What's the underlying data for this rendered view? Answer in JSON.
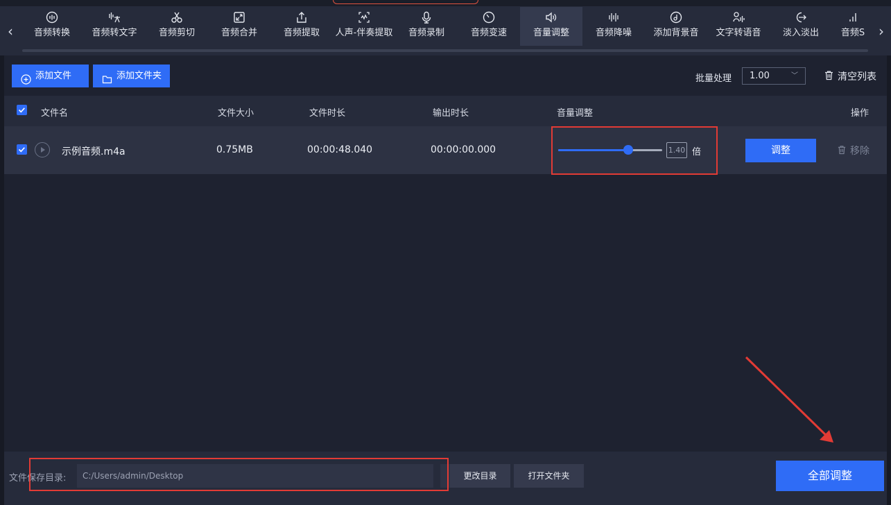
{
  "toolbar": {
    "items": [
      {
        "label": "音频转换",
        "icon": "audio-convert-icon"
      },
      {
        "label": "音频转文字",
        "icon": "speech-to-text-icon"
      },
      {
        "label": "音频剪切",
        "icon": "scissors-icon"
      },
      {
        "label": "音频合并",
        "icon": "merge-icon"
      },
      {
        "label": "音频提取",
        "icon": "extract-icon"
      },
      {
        "label": "人声-伴奏提取",
        "icon": "vocal-separate-icon"
      },
      {
        "label": "音频录制",
        "icon": "microphone-icon"
      },
      {
        "label": "音频变速",
        "icon": "speed-icon"
      },
      {
        "label": "音量调整",
        "icon": "volume-icon",
        "active": true
      },
      {
        "label": "音频降噪",
        "icon": "noise-reduce-icon"
      },
      {
        "label": "添加背景音",
        "icon": "background-music-icon"
      },
      {
        "label": "文字转语音",
        "icon": "text-to-speech-icon"
      },
      {
        "label": "淡入淡出",
        "icon": "fade-icon"
      },
      {
        "label": "音频S",
        "icon": "audio-bars-icon"
      }
    ],
    "prev_icon": "chevron-left-icon",
    "next_icon": "chevron-right-icon"
  },
  "actions": {
    "add_file": "添加文件",
    "add_folder": "添加文件夹",
    "batch_label": "批量处理",
    "batch_value": "1.00",
    "clear_list": "清空列表"
  },
  "table": {
    "headers": {
      "name": "文件名",
      "size": "文件大小",
      "duration": "文件时长",
      "output_duration": "输出时长",
      "volume": "音量调整",
      "operation": "操作"
    },
    "rows": [
      {
        "name": "示例音频.m4a",
        "size": "0.75MB",
        "duration": "00:00:48.040",
        "output_duration": "00:00:00.000",
        "volume_value": "1.40",
        "volume_unit": "倍",
        "volume_level": 0.67,
        "adjust": "调整",
        "remove": "移除",
        "checked": true
      }
    ]
  },
  "bottom": {
    "save_label": "文件保存目录:",
    "save_path": "C:/Users/admin/Desktop",
    "change_dir": "更改目录",
    "open_folder": "打开文件夹",
    "adjust_all": "全部调整"
  },
  "colors": {
    "accent": "#2f6cf6",
    "annotation": "#e23b35",
    "background": "#1e2230",
    "panel": "#262b3b"
  }
}
